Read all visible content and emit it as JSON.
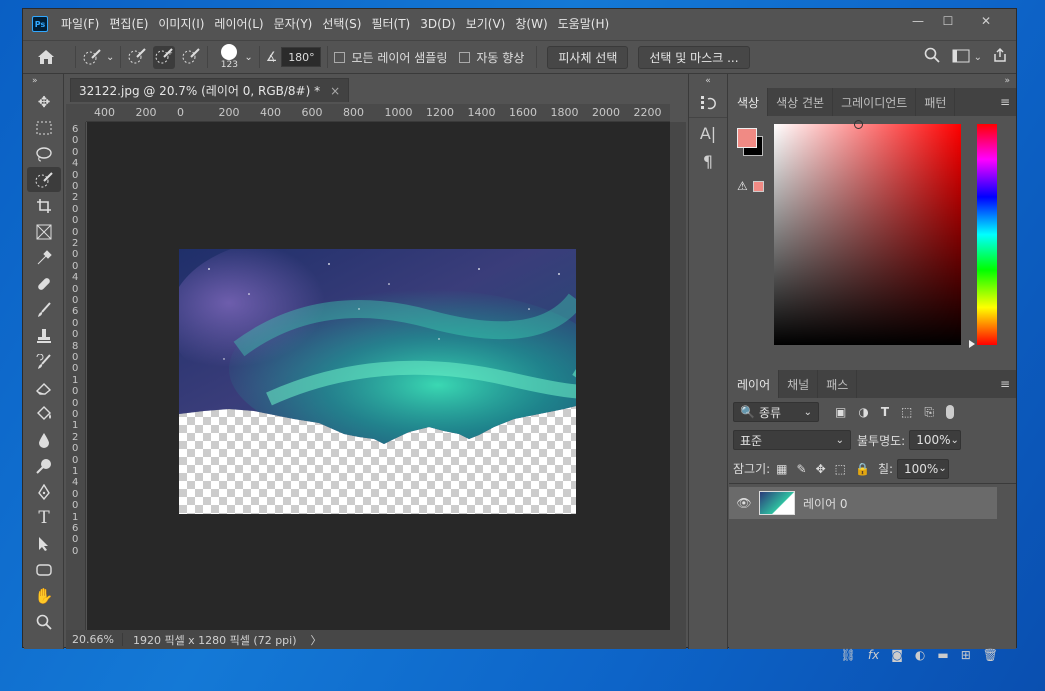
{
  "app": {
    "logo": "Ps"
  },
  "menu": [
    "파일(F)",
    "편집(E)",
    "이미지(I)",
    "레이어(L)",
    "문자(Y)",
    "선택(S)",
    "필터(T)",
    "3D(D)",
    "보기(V)",
    "창(W)",
    "도움말(H)"
  ],
  "window_controls": {
    "minimize": "—",
    "maximize": "☐",
    "close": "✕"
  },
  "options": {
    "brush_size": "123",
    "angle": "180°",
    "sample_all_label": "모든 레이어 샘플링",
    "auto_enhance_label": "자동 향상",
    "select_subject": "피사체 선택",
    "select_mask": "선택 및 마스크 ..."
  },
  "document": {
    "tab_title": "32122.jpg @ 20.7% (레이어 0, RGB/8#) *",
    "tab_close": "×",
    "ruler_h": [
      "400",
      "200",
      "0",
      "200",
      "400",
      "600",
      "800",
      "1000",
      "1200",
      "1400",
      "1600",
      "1800",
      "2000",
      "2200"
    ],
    "ruler_v": [
      "6",
      "0",
      "0",
      "4",
      "0",
      "0",
      "2",
      "0",
      "0",
      "0",
      "2",
      "0",
      "0",
      "4",
      "0",
      "0",
      "6",
      "0",
      "0",
      "8",
      "0",
      "0",
      "1",
      "0",
      "0",
      "0",
      "1",
      "2",
      "0",
      "0",
      "1",
      "4",
      "0",
      "0",
      "1",
      "6",
      "0",
      "0"
    ]
  },
  "status": {
    "zoom": "20.66%",
    "info": "1920 픽셀 x 1280 픽셀 (72 ppi)",
    "arrow": "〉"
  },
  "color_panel": {
    "tabs": [
      "색상",
      "색상 견본",
      "그레이디언트",
      "패턴"
    ],
    "fg_color": "#f08a84",
    "bg_color": "#000000",
    "hue_color": "#ff0000"
  },
  "layers_panel": {
    "tabs": [
      "레이어",
      "채널",
      "패스"
    ],
    "filter_kind": "종류",
    "blend_mode": "표준",
    "opacity_label": "불투명도:",
    "opacity_value": "100%",
    "lock_label": "잠그기:",
    "fill_label": "칠:",
    "fill_value": "100%",
    "layer_name": "레이어 0"
  }
}
